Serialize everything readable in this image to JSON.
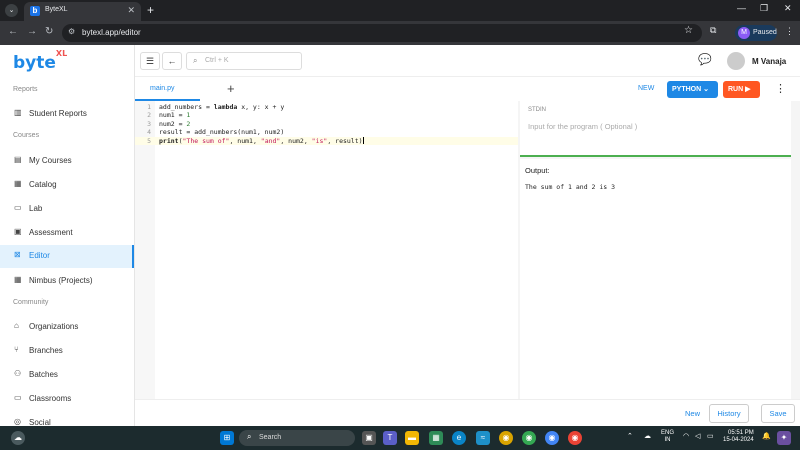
{
  "browser": {
    "tab_title": "ByteXL",
    "tab_icon": "b",
    "url": "bytexl.app/editor",
    "profile_initial": "M",
    "profile_status": "Paused"
  },
  "sidebar": {
    "logo_text": "byte",
    "logo_sup": "XL",
    "sections": [
      {
        "label": "Reports"
      },
      {
        "label": "Courses"
      },
      {
        "label": "Community"
      }
    ],
    "items": [
      {
        "label": "Student Reports",
        "icon": "bar-chart-icon"
      },
      {
        "label": "My Courses",
        "icon": "book-icon"
      },
      {
        "label": "Catalog",
        "icon": "catalog-icon"
      },
      {
        "label": "Lab",
        "icon": "laptop-icon"
      },
      {
        "label": "Assessment",
        "icon": "assessment-icon"
      },
      {
        "label": "Editor",
        "icon": "editor-icon",
        "active": true
      },
      {
        "label": "Nimbus (Projects)",
        "icon": "grid-icon"
      },
      {
        "label": "Organizations",
        "icon": "building-icon"
      },
      {
        "label": "Branches",
        "icon": "branch-icon"
      },
      {
        "label": "Batches",
        "icon": "people-icon"
      },
      {
        "label": "Classrooms",
        "icon": "classroom-icon"
      },
      {
        "label": "Social",
        "icon": "social-icon"
      }
    ]
  },
  "topbar": {
    "search_placeholder": "Ctrl + K",
    "user_name": "M Vanaja"
  },
  "editor": {
    "file_tab": "main.py",
    "new_label": "NEW",
    "language_label": "PYTHON",
    "run_label": "RUN",
    "code_lines": [
      {
        "n": "1",
        "code": "add_numbers = lambda x, y: x + y"
      },
      {
        "n": "2",
        "code": "num1 = 1"
      },
      {
        "n": "3",
        "code": "num2 = 2"
      },
      {
        "n": "4",
        "code": "result = add_numbers(num1, num2)"
      },
      {
        "n": "5",
        "code": "print(\"The sum of\", num1, \"and\", num2, \"is\", result)"
      }
    ],
    "stdin_label": "STDIN",
    "stdin_placeholder": "Input for the program ( Optional )",
    "output_label": "Output:",
    "output_text": "The sum of 1 and 2 is 3"
  },
  "bottom": {
    "new_label": "New",
    "history_label": "History",
    "save_label": "Save"
  },
  "taskbar": {
    "search_label": "Search",
    "lang_top": "ENG",
    "lang_bottom": "IN",
    "time": "05:51 PM",
    "date": "15-04-2024"
  }
}
